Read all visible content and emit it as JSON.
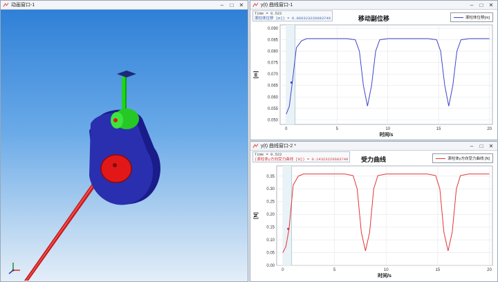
{
  "anim_window": {
    "title": "动画窗口-1",
    "controls": {
      "minimize": "–",
      "maximize": "□",
      "close": "✕"
    }
  },
  "curve1": {
    "title": "y(t) 曲线窗口-1",
    "controls": {
      "minimize": "–",
      "maximize": "□",
      "close": "✕"
    },
    "readout": {
      "time": "Time = 0.522",
      "value": "滚柱体位移 [m]) = 0.0663232266837​49"
    },
    "plot_title": "移动副位移",
    "legend": "滚柱体位移[m]",
    "color": "#3b45c8"
  },
  "curve2": {
    "title": "y(t) 曲线窗口-2 *",
    "controls": {
      "minimize": "–",
      "maximize": "□",
      "close": "✕"
    },
    "readout": {
      "time": "Time = 0.522",
      "value": "(滚柱体y方向受力曲线 [N]) = 0.143232266837​49"
    },
    "plot_title": "受力曲线",
    "legend": "滚柱体y方向受力曲线 [N]",
    "color": "#e23434"
  },
  "chart_data": [
    {
      "type": "line",
      "title": "移动副位移",
      "xlabel": "时间/s",
      "ylabel": "[m]",
      "xlim": [
        -0.6,
        20.3
      ],
      "ylim": [
        0.048,
        0.0915
      ],
      "xticks": [
        "0",
        "5",
        "10",
        "15",
        "20"
      ],
      "yticks": [
        "0.050",
        "0.055",
        "0.060",
        "0.065",
        "0.070",
        "0.075",
        "0.080",
        "0.085",
        "0.090"
      ],
      "grid": true,
      "legend_position": "top-right",
      "cursor": {
        "x": 0.522,
        "y": 0.0663
      },
      "series": [
        {
          "name": "滚柱体位移[m]",
          "color": "#3b45c8",
          "x": [
            0,
            0.3,
            0.6,
            1.0,
            1.5,
            2.0,
            2.5,
            3,
            4,
            5,
            6,
            6.8,
            7.2,
            7.6,
            8.0,
            8.4,
            8.8,
            9.2,
            10,
            11,
            12,
            13,
            14,
            14.8,
            15.2,
            15.6,
            16.0,
            16.4,
            16.8,
            17.2,
            18,
            19,
            20
          ],
          "y": [
            0.0525,
            0.0558,
            0.0663,
            0.0815,
            0.0845,
            0.0855,
            0.0855,
            0.0855,
            0.0855,
            0.0855,
            0.0855,
            0.085,
            0.08,
            0.065,
            0.056,
            0.065,
            0.08,
            0.085,
            0.0855,
            0.0855,
            0.0855,
            0.0855,
            0.0855,
            0.085,
            0.08,
            0.065,
            0.056,
            0.065,
            0.08,
            0.085,
            0.0855,
            0.0855,
            0.0855
          ]
        }
      ]
    },
    {
      "type": "line",
      "title": "受力曲线",
      "xlabel": "时间/s",
      "ylabel": "[N]",
      "xlim": [
        -0.6,
        20.3
      ],
      "ylim": [
        0.0,
        0.39
      ],
      "xticks": [
        "0",
        "5",
        "10",
        "15",
        "20"
      ],
      "yticks": [
        "0.00",
        "0.05",
        "0.10",
        "0.15",
        "0.20",
        "0.25",
        "0.30",
        "0.35"
      ],
      "grid": true,
      "legend_position": "top-right",
      "cursor": {
        "x": 0.522,
        "y": 0.1432
      },
      "series": [
        {
          "name": "滚柱体y方向受力曲线 [N]",
          "color": "#e23434",
          "x": [
            0,
            0.3,
            0.6,
            1.0,
            1.5,
            2.0,
            2.5,
            3,
            4,
            5,
            6,
            6.8,
            7.2,
            7.6,
            8.0,
            8.4,
            8.8,
            9.2,
            10,
            11,
            12,
            13,
            14,
            14.8,
            15.2,
            15.6,
            16.0,
            16.4,
            16.8,
            17.2,
            18,
            19,
            20
          ],
          "y": [
            0.05,
            0.075,
            0.143,
            0.315,
            0.35,
            0.358,
            0.358,
            0.358,
            0.358,
            0.358,
            0.358,
            0.352,
            0.3,
            0.13,
            0.057,
            0.13,
            0.3,
            0.352,
            0.358,
            0.358,
            0.358,
            0.358,
            0.358,
            0.352,
            0.3,
            0.13,
            0.057,
            0.13,
            0.3,
            0.352,
            0.358,
            0.358,
            0.358
          ]
        }
      ]
    }
  ]
}
